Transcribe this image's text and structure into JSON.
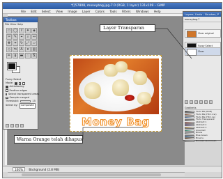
{
  "window": {
    "title": "*[[57808, moneybag.jpg-7.0 (RGB, 1 layer) 131x109 – GIMP"
  },
  "menubar": {
    "items": [
      "File",
      "Edit",
      "Select",
      "View",
      "Image",
      "Layer",
      "Colors",
      "Tools",
      "Filters",
      "Windows",
      "Help"
    ]
  },
  "toolbox": {
    "title": "Toolbox",
    "menu": "File  Xtns  Help",
    "options_title": "Fuzzy Select",
    "options": {
      "mode_label": "Mode:",
      "antialiasing": "Antialiasing",
      "feather_edges": "Feather edges",
      "select_transparent": "Select transparent areas",
      "sample_merged": "Sample merged",
      "threshold_label": "Threshold:",
      "threshold_value": "15",
      "select_by_label": "Select by:",
      "select_by_value": "Composite"
    }
  },
  "image": {
    "text": "Money Bag"
  },
  "dock": {
    "title": "Layers, Undo – Brushes, P",
    "image_selector": "moneybag-7",
    "layers": [
      {
        "name": "Clear original",
        "color": "#d0762a"
      },
      {
        "name": "Fuzzy Select",
        "color": "#111111"
      },
      {
        "name": "Clear",
        "color": "#ffffff"
      }
    ],
    "gradients_title": "Gradients",
    "gradients": [
      {
        "name": "FG to BG (RGB)",
        "color": "#333333"
      },
      {
        "name": "FG to BG (HSV ccw)",
        "color": "#8f5a3e"
      },
      {
        "name": "FG to BG (HSV cw)",
        "color": "#4a72a8"
      },
      {
        "name": "FG to Transparent",
        "color": "#777777"
      },
      {
        "name": "Abstract 1",
        "color": "#c7493d"
      },
      {
        "name": "Abstract 2",
        "color": "#6a3aa0"
      },
      {
        "name": "Abstract 3",
        "color": "#d9a23a"
      },
      {
        "name": "Aneurism",
        "color": "#2a8a6a"
      },
      {
        "name": "Blinds",
        "color": "#999999"
      },
      {
        "name": "Blue Green",
        "color": "#2f6fb0"
      },
      {
        "name": "Browns",
        "color": "#7a4e2a"
      },
      {
        "name": "Brushed Aluminium",
        "color": "#bdbdbd"
      }
    ]
  },
  "status": {
    "zoom": "100%",
    "text": "Background (2.8 MB)"
  },
  "annotations": {
    "layer_transparent": "Layer Transparan",
    "orange_removed": "Warna Orange telah dihapus"
  }
}
